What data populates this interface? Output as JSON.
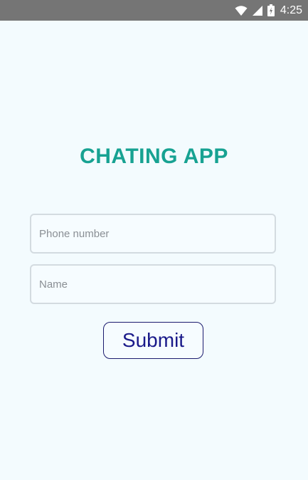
{
  "status_bar": {
    "time": "4:25",
    "icons": [
      "wifi-icon",
      "signal-icon",
      "battery-icon"
    ]
  },
  "app": {
    "title": "CHATING APP"
  },
  "form": {
    "phone_placeholder": "Phone number",
    "phone_value": "",
    "name_placeholder": "Name",
    "name_value": "",
    "submit_label": "Submit"
  },
  "colors": {
    "status_bar": "#757575",
    "background": "#f3fbfe",
    "title": "#17a292",
    "field_border": "#d3dbe0",
    "button_text": "#1a1a8a",
    "button_border": "#1b1b6e"
  }
}
